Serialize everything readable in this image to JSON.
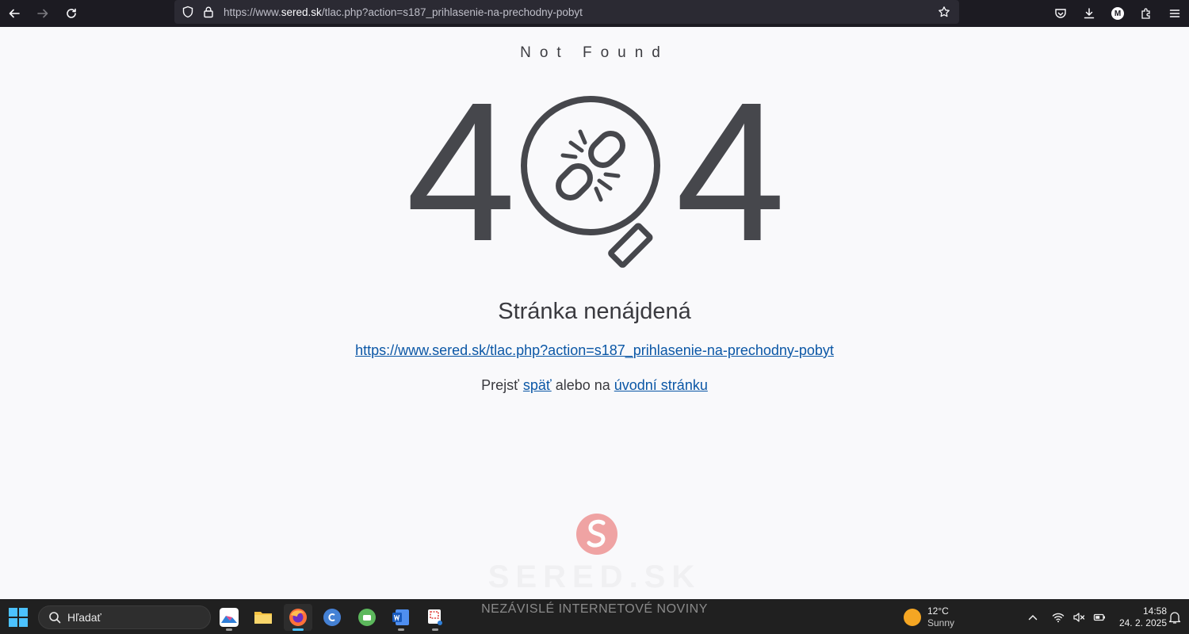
{
  "browser": {
    "url_scheme": "https://www.",
    "url_host": "sered.sk",
    "url_path": "/tlac.php?action=s187_prihlasenie-na-prechodny-pobyt",
    "profile_initial": "M"
  },
  "page": {
    "not_found": "Not Found",
    "digit_left": "4",
    "digit_right": "4",
    "heading": "Stránka nenájdená",
    "broken_url": "https://www.sered.sk/tlac.php?action=s187_prihlasenie-na-prechodny-pobyt",
    "nav_prefix": "Prejsť ",
    "back_link": "späť",
    "nav_middle": " alebo na ",
    "home_link": "úvodní stránku",
    "logo_word": "SERED.SK",
    "tagline": "NEZÁVISLÉ INTERNETOVÉ NOVINY"
  },
  "taskbar": {
    "search_placeholder": "Hľadať",
    "weather_temp": "12°C",
    "weather_cond": "Sunny",
    "time": "14:58",
    "date": "24. 2. 2025"
  },
  "colors": {
    "browser_chrome": "#1c1b22",
    "url_bar": "#2b2a33",
    "link": "#0b57a6",
    "icon_gray": "#46474c",
    "logo_pink": "#ef9a9a",
    "taskbar": "#202020",
    "active_indicator": "#4cc2ff"
  }
}
